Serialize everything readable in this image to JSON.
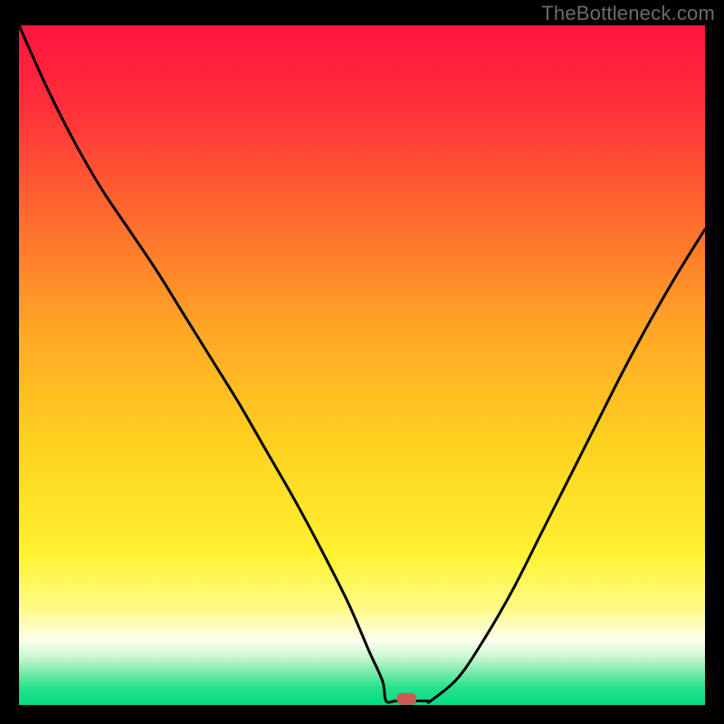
{
  "watermark": "TheBottleneck.com",
  "chart_data": {
    "type": "line",
    "title": "",
    "xlabel": "",
    "ylabel": "",
    "xlim": [
      0,
      100
    ],
    "ylim": [
      0,
      100
    ],
    "background_gradient": {
      "stops": [
        {
          "offset": 0.0,
          "color": "#ff1440"
        },
        {
          "offset": 0.12,
          "color": "#ff2f3a"
        },
        {
          "offset": 0.28,
          "color": "#ff6a2f"
        },
        {
          "offset": 0.45,
          "color": "#ffa726"
        },
        {
          "offset": 0.62,
          "color": "#ffd21f"
        },
        {
          "offset": 0.78,
          "color": "#fff233"
        },
        {
          "offset": 0.86,
          "color": "#fffb8a"
        },
        {
          "offset": 0.905,
          "color": "#fdfff0"
        },
        {
          "offset": 0.93,
          "color": "#c7f7cf"
        },
        {
          "offset": 0.955,
          "color": "#6fe9a6"
        },
        {
          "offset": 0.975,
          "color": "#25e28c"
        },
        {
          "offset": 1.0,
          "color": "#07dd82"
        }
      ]
    },
    "series": [
      {
        "name": "bottleneck-curve",
        "x": [
          0,
          4,
          8,
          12,
          16,
          20,
          24,
          28,
          32,
          36,
          40,
          44,
          48,
          51,
          53,
          55,
          57,
          60,
          64,
          68,
          72,
          76,
          80,
          84,
          88,
          92,
          96,
          100
        ],
        "y": [
          100,
          91,
          83,
          76,
          70,
          64,
          57.5,
          51,
          44.5,
          37.5,
          30.5,
          23,
          15,
          8,
          3.5,
          1.2,
          0.6,
          0.6,
          4,
          10,
          17,
          25,
          33,
          41,
          49,
          56.5,
          63.5,
          70
        ]
      }
    ],
    "marker": {
      "x": 56.5,
      "y": 0.9,
      "color": "#c95b52"
    },
    "flat_segment": {
      "x_start": 53.5,
      "x_end": 59.5,
      "y": 0.6
    }
  }
}
